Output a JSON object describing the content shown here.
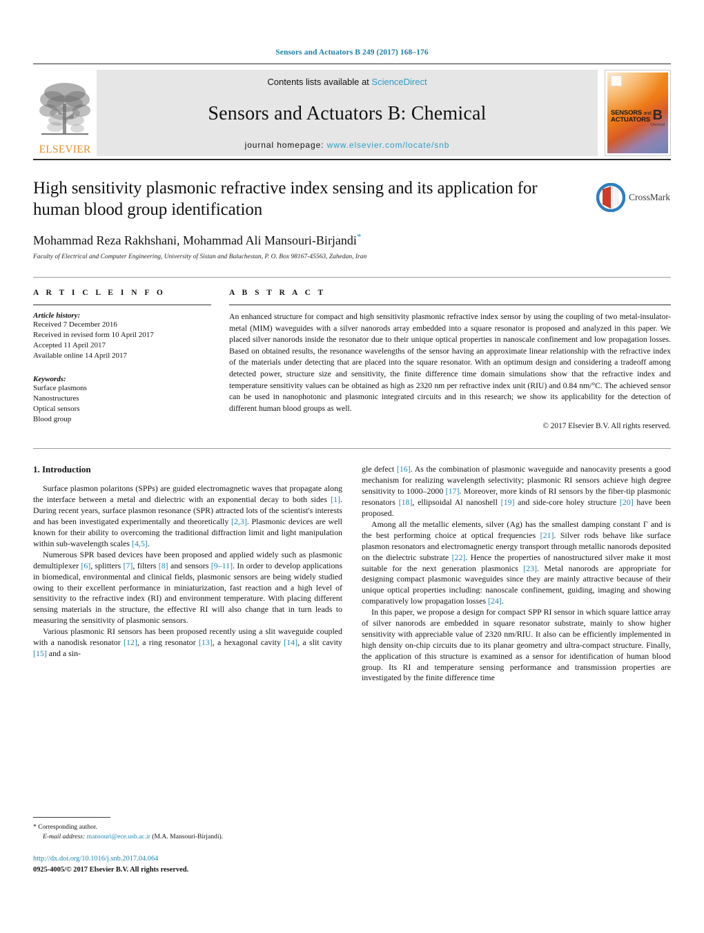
{
  "running_head": "Sensors and Actuators B 249 (2017) 168–176",
  "masthead": {
    "contents_prefix": "Contents lists available at ",
    "sciencedirect": "ScienceDirect",
    "journal_title": "Sensors and Actuators B: Chemical",
    "homepage_prefix": "journal homepage: ",
    "homepage_url": "www.elsevier.com/locate/snb",
    "publisher_wordmark": "ELSEVIER",
    "cover": {
      "line1": "SENSORS",
      "and": "and",
      "line2": "ACTUATORS",
      "letter": "B",
      "sub": "Chemical"
    }
  },
  "article": {
    "title": "High sensitivity plasmonic refractive index sensing and its application for human blood group identification",
    "authors": "Mohammad Reza Rakhshani, Mohammad Ali Mansouri-Birjandi",
    "corresponding_marker": "*",
    "affiliation": "Faculty of Electrical and Computer Engineering, University of Sistan and Baluchestan, P. O. Box 98167-45563, Zahedan, Iran",
    "crossmark_label": "CrossMark"
  },
  "article_info": {
    "heading": "A R T I C L E    I N F O",
    "history_label": "Article history:",
    "history": [
      "Received 7 December 2016",
      "Received in revised form 10 April 2017",
      "Accepted 11 April 2017",
      "Available online 14 April 2017"
    ],
    "keywords_label": "Keywords:",
    "keywords": [
      "Surface plasmons",
      "Nanostructures",
      "Optical sensors",
      "Blood group"
    ]
  },
  "abstract": {
    "heading": "A B S T R A C T",
    "text": "An enhanced structure for compact and high sensitivity plasmonic refractive index sensor by using the coupling of two metal-insulator-metal (MIM) waveguides with a silver nanorods array embedded into a square resonator is proposed and analyzed in this paper. We placed silver nanorods inside the resonator due to their unique optical properties in nanoscale confinement and low propagation losses. Based on obtained results, the resonance wavelengths of the sensor having an approximate linear relationship with the refractive index of the materials under detecting that are placed into the square resonator. With an optimum design and considering a tradeoff among detected power, structure size and sensitivity, the finite difference time domain simulations show that the refractive index and temperature sensitivity values can be obtained as high as 2320 nm per refractive index unit (RIU) and 0.84 nm/°C. The achieved sensor can be used in nanophotonic and plasmonic integrated circuits and in this research; we show its applicability for the detection of different human blood groups as well.",
    "copyright": "© 2017 Elsevier B.V. All rights reserved."
  },
  "body": {
    "section_title": "1.  Introduction",
    "left_paragraphs": [
      "Surface plasmon polaritons (SPPs) are guided electromagnetic waves that propagate along the interface between a metal and dielectric with an exponential decay to both sides [1]. During recent years, surface plasmon resonance (SPR) attracted lots of the scientist's interests and has been investigated experimentally and theoretically [2,3]. Plasmonic devices are well known for their ability to overcoming the traditional diffraction limit and light manipulation within sub-wavelength scales [4,5].",
      "Numerous SPR based devices have been proposed and applied widely such as plasmonic demultiplexer [6], splitters [7], filters [8] and sensors [9–11]. In order to develop applications in biomedical, environmental and clinical fields, plasmonic sensors are being widely studied owing to their excellent performance in miniaturization, fast reaction and a high level of sensitivity to the refractive index (RI) and environment temperature. With placing different sensing materials in the structure, the effective RI will also change that in turn leads to measuring the sensitivity of plasmonic sensors.",
      "Various plasmonic RI sensors has been proposed recently using a slit waveguide coupled with a nanodisk resonator [12], a ring resonator [13], a hexagonal cavity [14], a slit cavity [15] and a sin-"
    ],
    "right_paragraphs": [
      "gle defect [16]. As the combination of plasmonic waveguide and nanocavity presents a good mechanism for realizing wavelength selectivity; plasmonic RI sensors achieve high degree sensitivity to 1000–2000 [17]. Moreover, more kinds of RI sensors by the fiber-tip plasmonic resonators [18], ellipsoidal Al nanoshell [19] and side-core holey structure [20] have been proposed.",
      "Among all the metallic elements, silver (Ag) has the smallest damping constant Γ and is the best performing choice at optical frequencies [21]. Silver rods behave like surface plasmon resonators and electromagnetic energy transport through metallic nanorods deposited on the dielectric substrate [22]. Hence the properties of nanostructured silver make it most suitable for the next generation plasmonics [23]. Metal nanorods are appropriate for designing compact plasmonic waveguides since they are mainly attractive because of their unique optical properties including: nanoscale confinement, guiding, imaging and showing comparatively low propagation losses [24].",
      "In this paper, we propose a design for compact SPP RI sensor in which square lattice array of silver nanorods are embedded in square resonator substrate, mainly to show higher sensitivity with appreciable value of 2320 nm/RIU. It also can be efficiently implemented in high density on-chip circuits due to its planar geometry and ultra-compact structure. Finally, the application of this structure is examined as a sensor for identification of human blood group. Its RI and temperature sensing performance and transmission properties are investigated by the finite difference time"
    ]
  },
  "footnote": {
    "corresponding": "*  Corresponding author.",
    "email_label": "E-mail address:",
    "email": "mansouri@ece.usb.ac.ir",
    "email_suffix": " (M.A. Mansouri-Birjandi).",
    "doi": "http://dx.doi.org/10.1016/j.snb.2017.04.064",
    "issn": "0925-4005/© 2017 Elsevier B.V. All rights reserved."
  },
  "colors": {
    "link": "#1f87b0",
    "accent_orange": "#ec8b22",
    "masthead_bg": "#e6e6e6"
  }
}
